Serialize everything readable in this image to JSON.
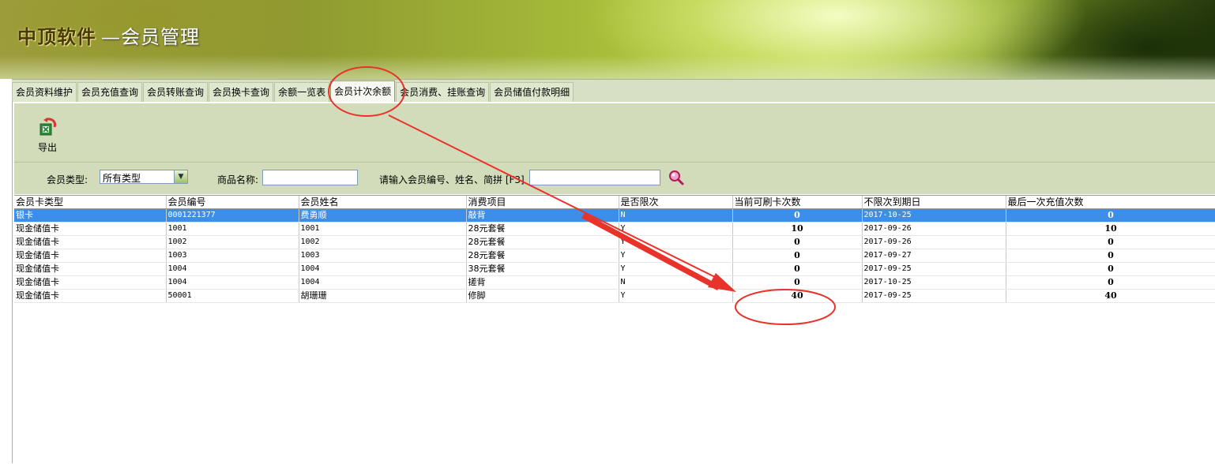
{
  "app": {
    "brand": "中顶软件",
    "module": "—会员管理"
  },
  "tabs": [
    {
      "label": "会员资料维护"
    },
    {
      "label": "会员充值查询"
    },
    {
      "label": "会员转账查询"
    },
    {
      "label": "会员换卡查询"
    },
    {
      "label": "余额一览表"
    },
    {
      "label": "会员计次余额",
      "active": true
    },
    {
      "label": "会员消费、挂账查询"
    },
    {
      "label": "会员储值付款明细"
    }
  ],
  "toolbar": {
    "export_label": "导出"
  },
  "filters": {
    "member_type_label": "会员类型:",
    "member_type_value": "所有类型",
    "product_name_label": "商品名称:",
    "product_name_value": "",
    "search_label": "请输入会员编号、姓名、简拼 [F3]",
    "search_value": ""
  },
  "table": {
    "columns": [
      "会员卡类型",
      "会员编号",
      "会员姓名",
      "消费项目",
      "是否限次",
      "当前可刷卡次数",
      "不限次到期日",
      "最后一次充值次数"
    ],
    "rows": [
      [
        "银卡",
        "0001221377",
        "费勇顺",
        "敲背",
        "N",
        "0",
        "2017-10-25",
        "0"
      ],
      [
        "现金储值卡",
        "1001",
        "1001",
        "28元套餐",
        "Y",
        "10",
        "2017-09-26",
        "10"
      ],
      [
        "现金储值卡",
        "1002",
        "1002",
        "28元套餐",
        "Y",
        "0",
        "2017-09-26",
        "0"
      ],
      [
        "现金储值卡",
        "1003",
        "1003",
        "28元套餐",
        "Y",
        "0",
        "2017-09-27",
        "0"
      ],
      [
        "现金储值卡",
        "1004",
        "1004",
        "38元套餐",
        "Y",
        "0",
        "2017-09-25",
        "0"
      ],
      [
        "现金储值卡",
        "1004",
        "1004",
        "搓背",
        "N",
        "0",
        "2017-10-25",
        "0"
      ],
      [
        "现金储值卡",
        "50001",
        "胡珊珊",
        "修脚",
        "Y",
        "40",
        "2017-09-25",
        "40"
      ]
    ],
    "selected_row": 0
  },
  "colors": {
    "selection": "#3d8ee8",
    "annotation": "#e8322a",
    "toolbar_bg": "#d2dcba"
  }
}
